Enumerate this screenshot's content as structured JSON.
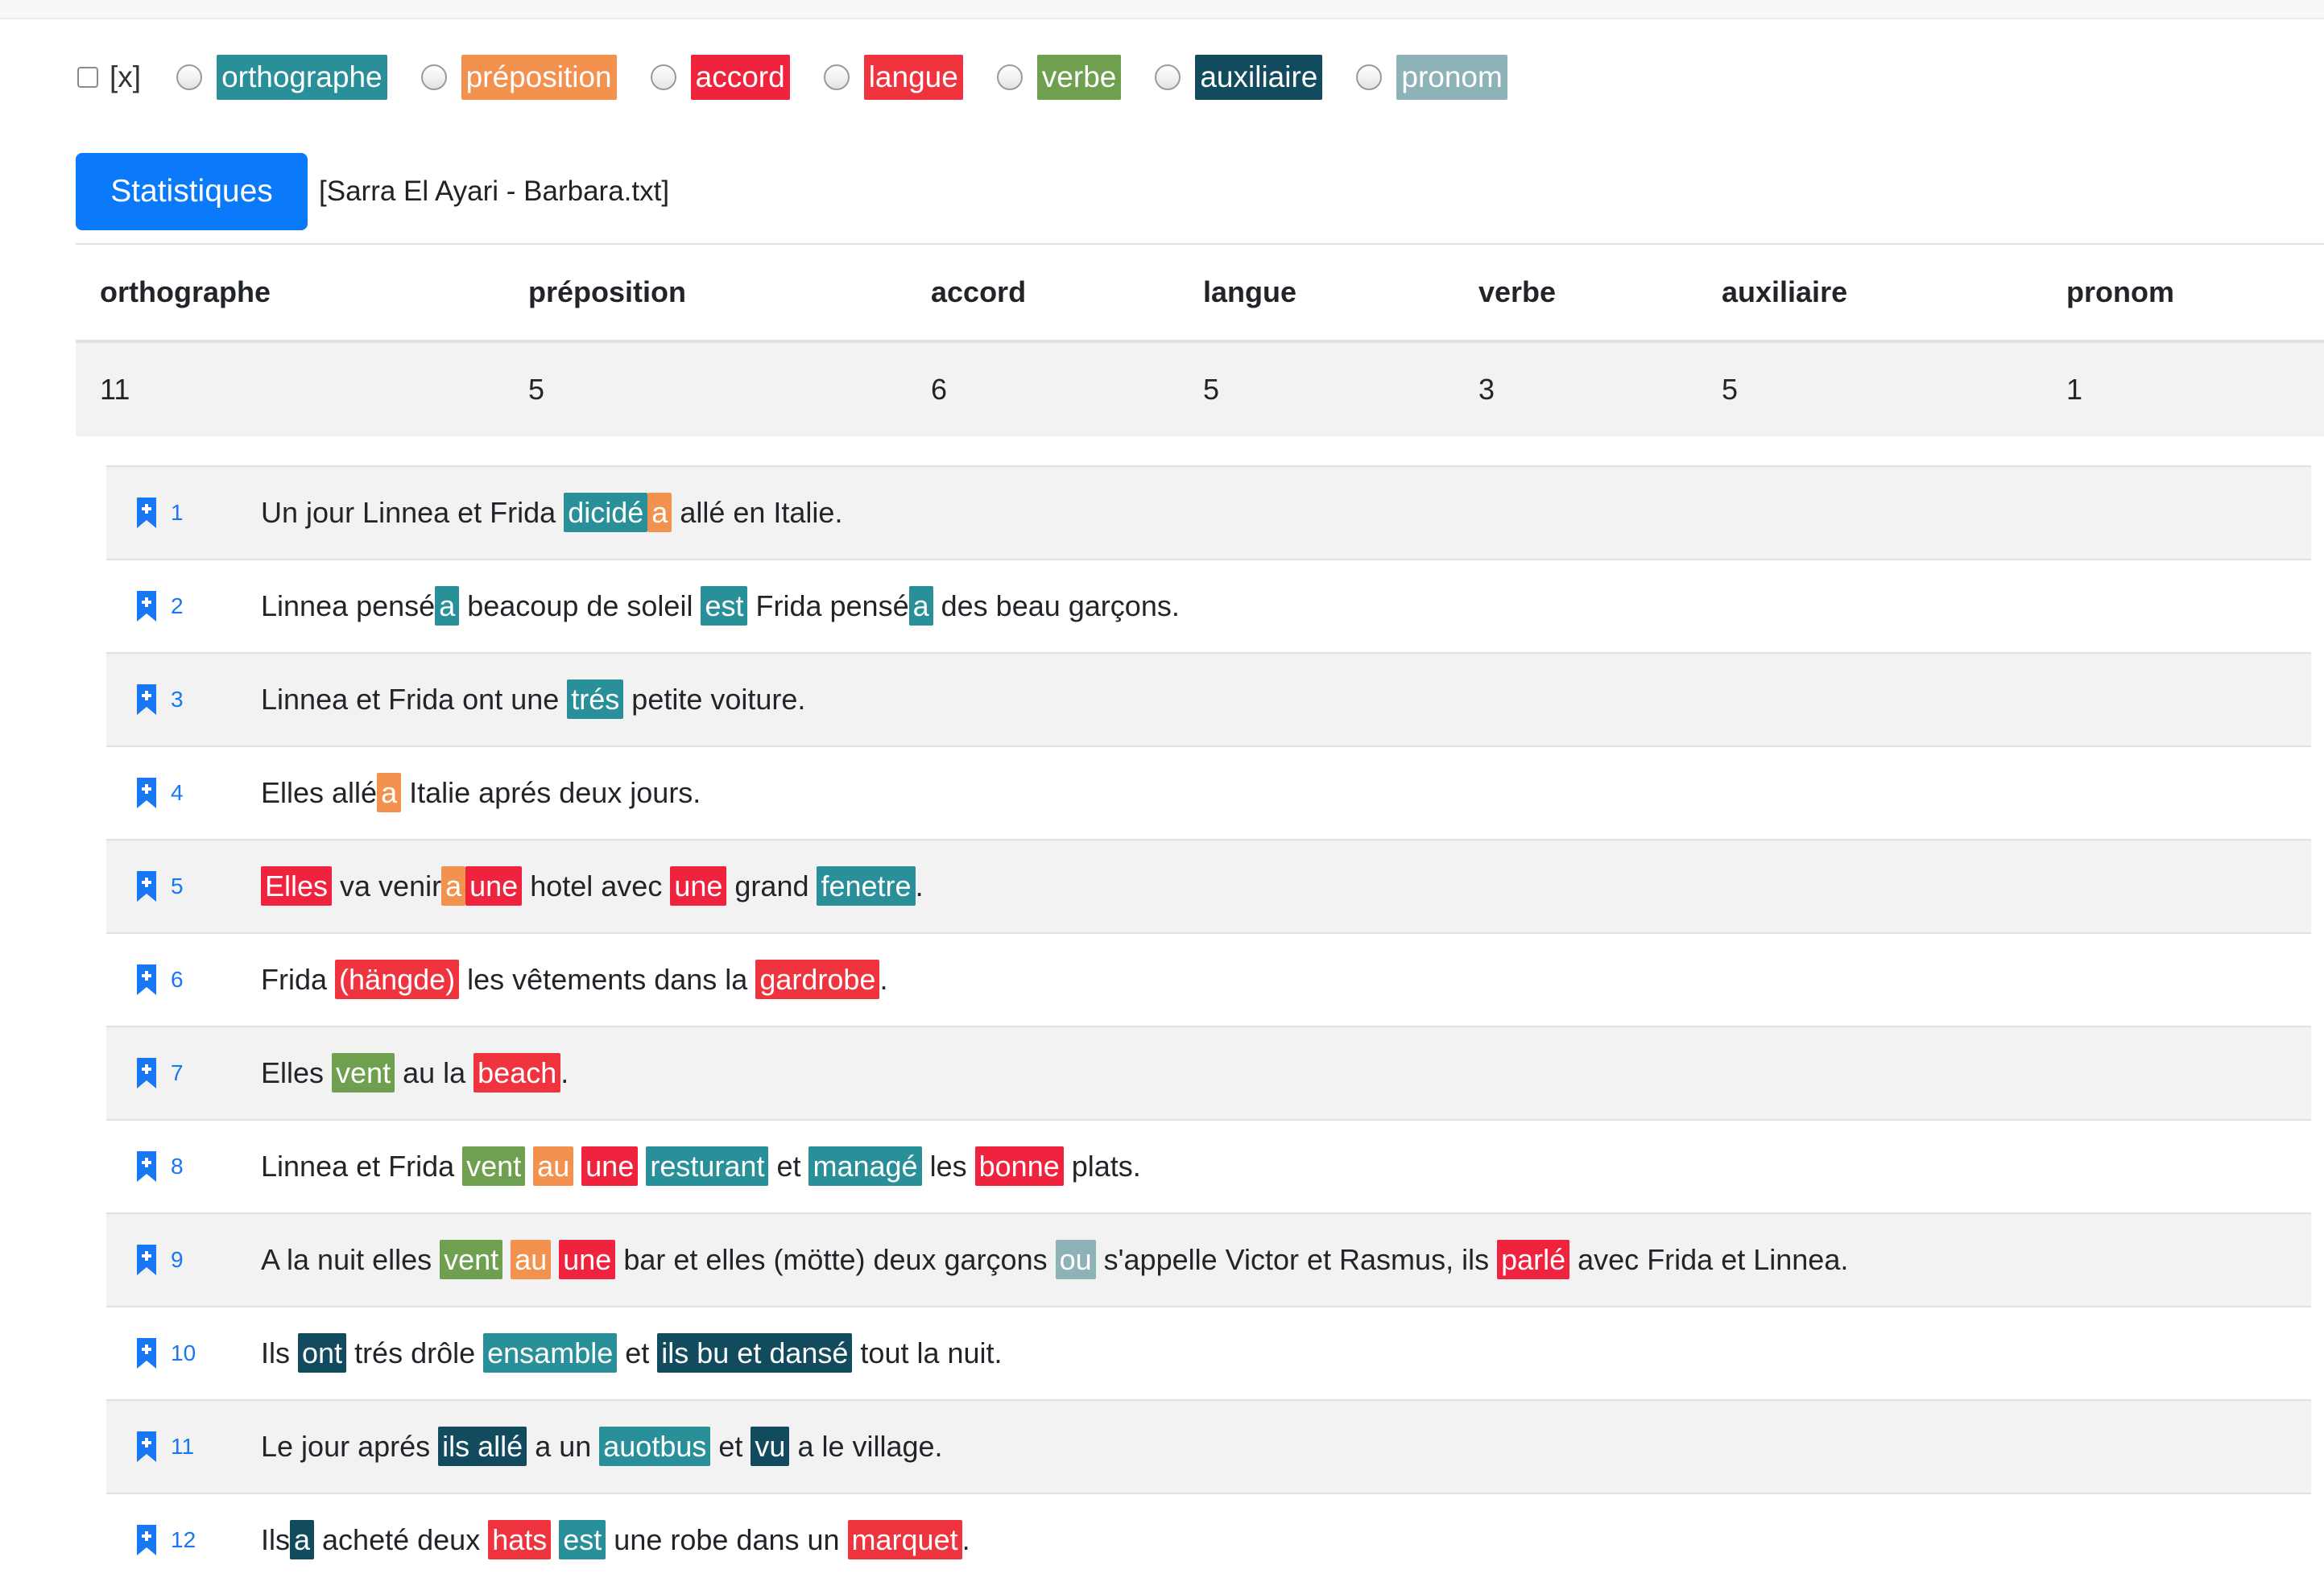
{
  "filter": {
    "checkbox_label": "[x]",
    "options": [
      {
        "label": "orthographe",
        "key": "orthographe"
      },
      {
        "label": "préposition",
        "key": "preposition"
      },
      {
        "label": "accord",
        "key": "accord"
      },
      {
        "label": "langue",
        "key": "langue"
      },
      {
        "label": "verbe",
        "key": "verbe"
      },
      {
        "label": "auxiliaire",
        "key": "auxiliaire"
      },
      {
        "label": "pronom",
        "key": "pronom"
      }
    ]
  },
  "colors": {
    "orthographe": "#29909a",
    "preposition": "#f3924e",
    "accord": "#f0233f",
    "langue": "#f0343f",
    "verbe": "#6ea050",
    "auxiliaire": "#124b5d",
    "pronom": "#8db3b9",
    "button": "#0a7afb"
  },
  "stats": {
    "button_label": "Statistiques",
    "file_label": "[Sarra El Ayari - Barbara.txt]",
    "headers": [
      "orthographe",
      "préposition",
      "accord",
      "langue",
      "verbe",
      "auxiliaire",
      "pronom"
    ],
    "values": [
      "11",
      "5",
      "6",
      "5",
      "3",
      "5",
      "1"
    ]
  },
  "icons": {
    "bookmark": "bookmark-plus-icon"
  },
  "sentences": [
    {
      "n": "1",
      "parts": [
        {
          "t": "Un jour Linnea et Frida "
        },
        {
          "t": "dicidé",
          "c": "orthographe"
        },
        {
          "t": "a",
          "c": "preposition"
        },
        {
          "t": " allé en Italie."
        }
      ]
    },
    {
      "n": "2",
      "parts": [
        {
          "t": "Linnea pensé"
        },
        {
          "t": "a",
          "c": "orthographe"
        },
        {
          "t": " beacoup de soleil "
        },
        {
          "t": "est",
          "c": "orthographe"
        },
        {
          "t": " Frida pensé"
        },
        {
          "t": "a",
          "c": "orthographe"
        },
        {
          "t": " des beau garçons."
        }
      ]
    },
    {
      "n": "3",
      "parts": [
        {
          "t": "Linnea et Frida ont une "
        },
        {
          "t": "trés",
          "c": "orthographe"
        },
        {
          "t": " petite voiture."
        }
      ]
    },
    {
      "n": "4",
      "parts": [
        {
          "t": "Elles allé"
        },
        {
          "t": "a",
          "c": "preposition"
        },
        {
          "t": " Italie aprés deux jours."
        }
      ]
    },
    {
      "n": "5",
      "parts": [
        {
          "t": "Elles",
          "c": "accord"
        },
        {
          "t": " va venir"
        },
        {
          "t": "a",
          "c": "preposition"
        },
        {
          "t": "une",
          "c": "accord"
        },
        {
          "t": " hotel avec "
        },
        {
          "t": "une",
          "c": "accord"
        },
        {
          "t": " grand "
        },
        {
          "t": "fenetre",
          "c": "orthographe"
        },
        {
          "t": "."
        }
      ]
    },
    {
      "n": "6",
      "parts": [
        {
          "t": "Frida "
        },
        {
          "t": "(hängde)",
          "c": "langue"
        },
        {
          "t": " les vêtements dans la "
        },
        {
          "t": "gardrobe",
          "c": "langue"
        },
        {
          "t": "."
        }
      ]
    },
    {
      "n": "7",
      "parts": [
        {
          "t": "Elles "
        },
        {
          "t": "vent",
          "c": "verbe"
        },
        {
          "t": " au la "
        },
        {
          "t": "beach",
          "c": "langue"
        },
        {
          "t": "."
        }
      ]
    },
    {
      "n": "8",
      "parts": [
        {
          "t": "Linnea et Frida "
        },
        {
          "t": "vent",
          "c": "verbe"
        },
        {
          "t": " "
        },
        {
          "t": "au",
          "c": "preposition"
        },
        {
          "t": " "
        },
        {
          "t": "une",
          "c": "accord"
        },
        {
          "t": " "
        },
        {
          "t": "resturant",
          "c": "orthographe"
        },
        {
          "t": " et "
        },
        {
          "t": "managé",
          "c": "orthographe"
        },
        {
          "t": " les "
        },
        {
          "t": "bonne",
          "c": "accord"
        },
        {
          "t": " plats."
        }
      ]
    },
    {
      "n": "9",
      "parts": [
        {
          "t": "A la nuit elles "
        },
        {
          "t": "vent",
          "c": "verbe"
        },
        {
          "t": " "
        },
        {
          "t": "au",
          "c": "preposition"
        },
        {
          "t": " "
        },
        {
          "t": "une",
          "c": "accord"
        },
        {
          "t": " bar et elles (mötte) deux garçons "
        },
        {
          "t": "ou",
          "c": "pronom"
        },
        {
          "t": " s'appelle Victor et Rasmus, ils "
        },
        {
          "t": "parlé",
          "c": "accord"
        },
        {
          "t": " avec Frida et Linnea."
        }
      ]
    },
    {
      "n": "10",
      "parts": [
        {
          "t": "Ils "
        },
        {
          "t": "ont",
          "c": "auxiliaire"
        },
        {
          "t": " trés drôle "
        },
        {
          "t": "ensamble",
          "c": "orthographe"
        },
        {
          "t": " et "
        },
        {
          "t": "ils bu et dansé",
          "c": "auxiliaire"
        },
        {
          "t": " tout la nuit."
        }
      ]
    },
    {
      "n": "11",
      "parts": [
        {
          "t": "Le jour aprés "
        },
        {
          "t": "ils allé",
          "c": "auxiliaire"
        },
        {
          "t": " a un "
        },
        {
          "t": "auotbus",
          "c": "orthographe"
        },
        {
          "t": " et "
        },
        {
          "t": "vu",
          "c": "auxiliaire"
        },
        {
          "t": " a le village."
        }
      ]
    },
    {
      "n": "12",
      "parts": [
        {
          "t": "Ils"
        },
        {
          "t": "a",
          "c": "auxiliaire"
        },
        {
          "t": " acheté deux "
        },
        {
          "t": "hats",
          "c": "langue"
        },
        {
          "t": " "
        },
        {
          "t": "est",
          "c": "orthographe"
        },
        {
          "t": " une robe dans un "
        },
        {
          "t": "marquet",
          "c": "langue"
        },
        {
          "t": "."
        }
      ]
    }
  ]
}
